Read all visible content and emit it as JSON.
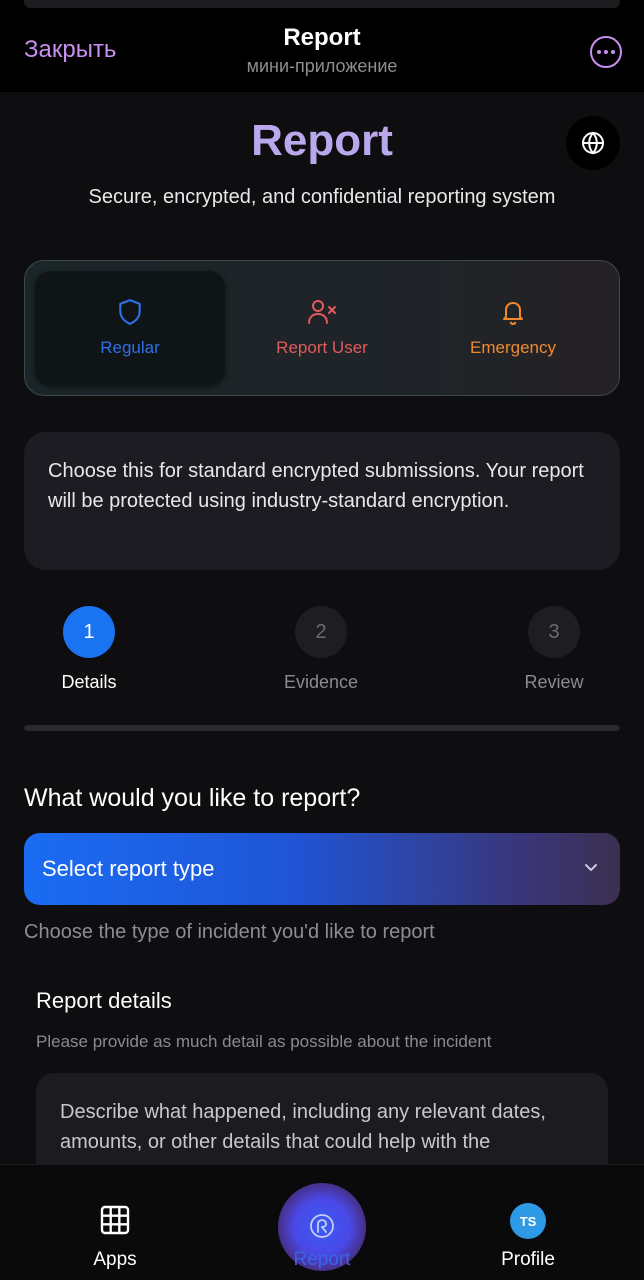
{
  "header": {
    "close_label": "Закрыть",
    "title": "Report",
    "subtitle": "мини-приложение"
  },
  "hero": {
    "title": "Report",
    "subtitle": "Secure, encrypted, and confidential reporting system"
  },
  "report_modes": [
    {
      "label": "Regular",
      "icon": "shield-icon",
      "color": "#2f6fe8",
      "active": true
    },
    {
      "label": "Report User",
      "icon": "user-x-icon",
      "color": "#e25a5a",
      "active": false
    },
    {
      "label": "Emergency",
      "icon": "bell-icon",
      "color": "#f08a2c",
      "active": false
    }
  ],
  "info_text": "Choose this for standard encrypted submissions. Your report will be protected using industry-standard encryption.",
  "steps": [
    {
      "number": "1",
      "label": "Details",
      "active": true
    },
    {
      "number": "2",
      "label": "Evidence",
      "active": false
    },
    {
      "number": "3",
      "label": "Review",
      "active": false
    }
  ],
  "form": {
    "question": "What would you like to report?",
    "select_placeholder": "Select report type",
    "select_helper": "Choose the type of incident you'd like to report",
    "details_title": "Report details",
    "details_subtitle": "Please provide as much detail as possible about the incident",
    "details_placeholder": "Describe what happened, including any relevant dates, amounts, or other details that could help with the"
  },
  "tabbar": {
    "apps_label": "Apps",
    "report_label": "Report",
    "profile_label": "Profile",
    "avatar_initials": "TS"
  },
  "colors": {
    "accent": "#1a73f0",
    "title_purple": "#b9a8ec",
    "close_purple": "#c98ef0"
  }
}
